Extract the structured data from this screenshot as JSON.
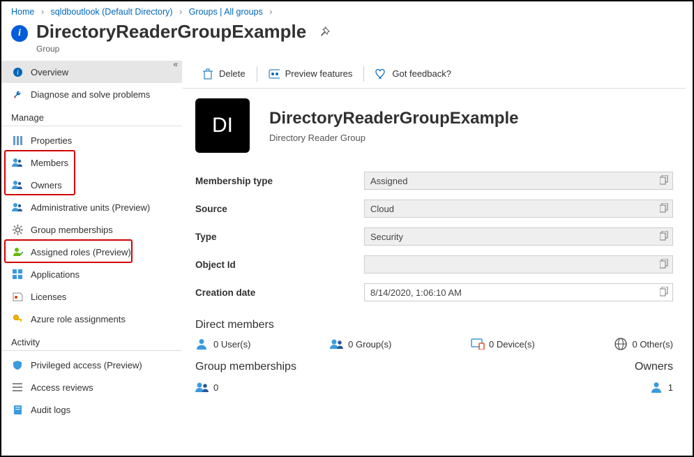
{
  "breadcrumb": [
    {
      "label": "Home"
    },
    {
      "label": "sqldboutlook (Default Directory)"
    },
    {
      "label": "Groups | All groups"
    }
  ],
  "header": {
    "title": "DirectoryReaderGroupExample",
    "subtitle": "Group"
  },
  "sidebar": {
    "items": [
      {
        "icon": "info",
        "label": "Overview",
        "selected": true
      },
      {
        "icon": "wrench",
        "label": "Diagnose and solve problems"
      }
    ],
    "manage_heading": "Manage",
    "manage": [
      {
        "icon": "props",
        "label": "Properties"
      },
      {
        "icon": "members",
        "label": "Members"
      },
      {
        "icon": "members",
        "label": "Owners"
      },
      {
        "icon": "members",
        "label": "Administrative units (Preview)"
      },
      {
        "icon": "gear",
        "label": "Group memberships"
      },
      {
        "icon": "person-green",
        "label": "Assigned roles (Preview)",
        "highlight": true
      },
      {
        "icon": "apps",
        "label": "Applications"
      },
      {
        "icon": "license",
        "label": "Licenses"
      },
      {
        "icon": "key",
        "label": "Azure role assignments"
      }
    ],
    "activity_heading": "Activity",
    "activity": [
      {
        "icon": "shield",
        "label": "Privileged access (Preview)"
      },
      {
        "icon": "list",
        "label": "Access reviews"
      },
      {
        "icon": "book",
        "label": "Audit logs"
      }
    ]
  },
  "toolbar": {
    "delete": "Delete",
    "preview": "Preview features",
    "feedback": "Got feedback?"
  },
  "entity": {
    "initials": "DI",
    "title": "DirectoryReaderGroupExample",
    "desc": "Directory Reader Group"
  },
  "props": {
    "membership_type": {
      "label": "Membership type",
      "value": "Assigned"
    },
    "source": {
      "label": "Source",
      "value": "Cloud"
    },
    "type": {
      "label": "Type",
      "value": "Security"
    },
    "object_id": {
      "label": "Object Id",
      "value": ""
    },
    "created": {
      "label": "Creation date",
      "value": "8/14/2020, 1:06:10 AM"
    }
  },
  "direct_members": {
    "heading": "Direct members",
    "users": {
      "count": 0,
      "label": "User(s)"
    },
    "groups": {
      "count": 0,
      "label": "Group(s)"
    },
    "devices": {
      "count": 0,
      "label": "Device(s)"
    },
    "others": {
      "count": 0,
      "label": "Other(s)"
    }
  },
  "group_memberships": {
    "heading": "Group memberships",
    "count": 0
  },
  "owners": {
    "heading": "Owners",
    "count": 1
  }
}
